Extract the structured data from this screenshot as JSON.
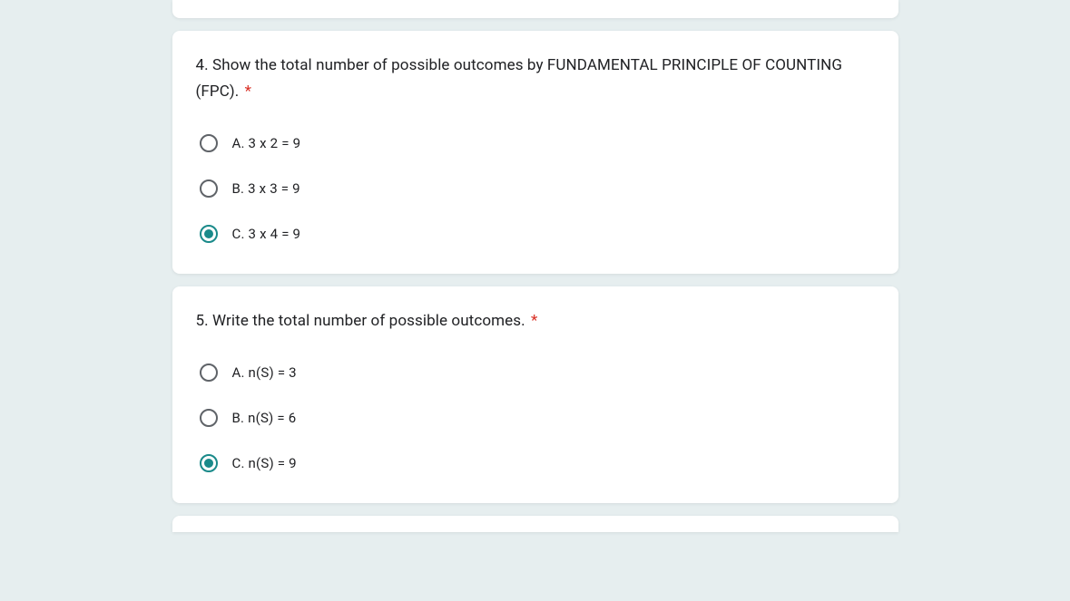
{
  "questions": [
    {
      "prompt": "4.    Show the total number of possible outcomes by FUNDAMENTAL PRINCIPLE OF COUNTING (FPC).",
      "required": "*",
      "options": [
        {
          "label": "A. 3 x 2 = 9",
          "selected": false
        },
        {
          "label": "B. 3 x 3 = 9",
          "selected": false
        },
        {
          "label": "C. 3 x 4 = 9",
          "selected": true
        }
      ]
    },
    {
      "prompt": "5.    Write the total number of possible outcomes.",
      "required": "*",
      "options": [
        {
          "label": "A. n(S) = 3",
          "selected": false
        },
        {
          "label": "B. n(S) = 6",
          "selected": false
        },
        {
          "label": "C. n(S) = 9",
          "selected": true
        }
      ]
    }
  ]
}
